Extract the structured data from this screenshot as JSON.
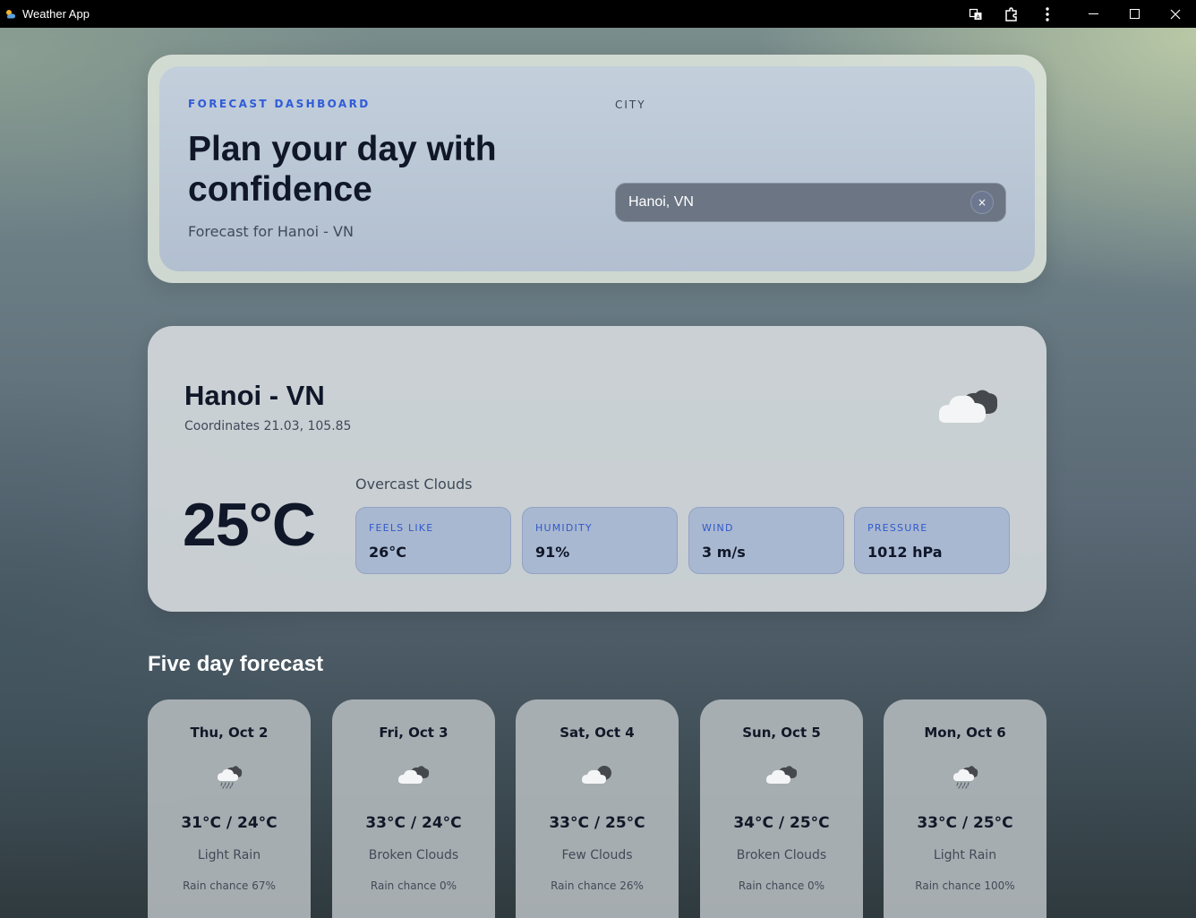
{
  "window": {
    "title": "Weather App"
  },
  "hero": {
    "eyebrow": "FORECAST DASHBOARD",
    "title": "Plan your day with confidence",
    "subtitle": "Forecast for Hanoi - VN",
    "city_label": "CITY",
    "city_value": "Hanoi, VN",
    "clear_label": "×"
  },
  "current": {
    "city": "Hanoi - VN",
    "coordinates": "Coordinates 21.03, 105.85",
    "temperature": "25°C",
    "description": "Overcast Clouds",
    "icon": "overcast-clouds-icon",
    "stats": [
      {
        "label": "FEELS LIKE",
        "value": "26°C"
      },
      {
        "label": "HUMIDITY",
        "value": "91%"
      },
      {
        "label": "WIND",
        "value": "3 m/s"
      },
      {
        "label": "PRESSURE",
        "value": "1012 hPa"
      }
    ]
  },
  "forecast": {
    "heading": "Five day forecast",
    "days": [
      {
        "date": "Thu, Oct 2",
        "temp": "31°C / 24°C",
        "desc": "Light Rain",
        "rain": "Rain chance 67%",
        "icon": "rain-icon"
      },
      {
        "date": "Fri, Oct 3",
        "temp": "33°C / 24°C",
        "desc": "Broken Clouds",
        "rain": "Rain chance 0%",
        "icon": "broken-clouds-icon"
      },
      {
        "date": "Sat, Oct 4",
        "temp": "33°C / 25°C",
        "desc": "Few Clouds",
        "rain": "Rain chance 26%",
        "icon": "few-clouds-icon"
      },
      {
        "date": "Sun, Oct 5",
        "temp": "34°C / 25°C",
        "desc": "Broken Clouds",
        "rain": "Rain chance 0%",
        "icon": "broken-clouds-icon"
      },
      {
        "date": "Mon, Oct 6",
        "temp": "33°C / 25°C",
        "desc": "Light Rain",
        "rain": "Rain chance 100%",
        "icon": "rain-icon"
      }
    ]
  },
  "colors": {
    "accent": "#2f5bd8",
    "text_dark": "#0f1729",
    "stat_bg": "#a9b8d1"
  }
}
